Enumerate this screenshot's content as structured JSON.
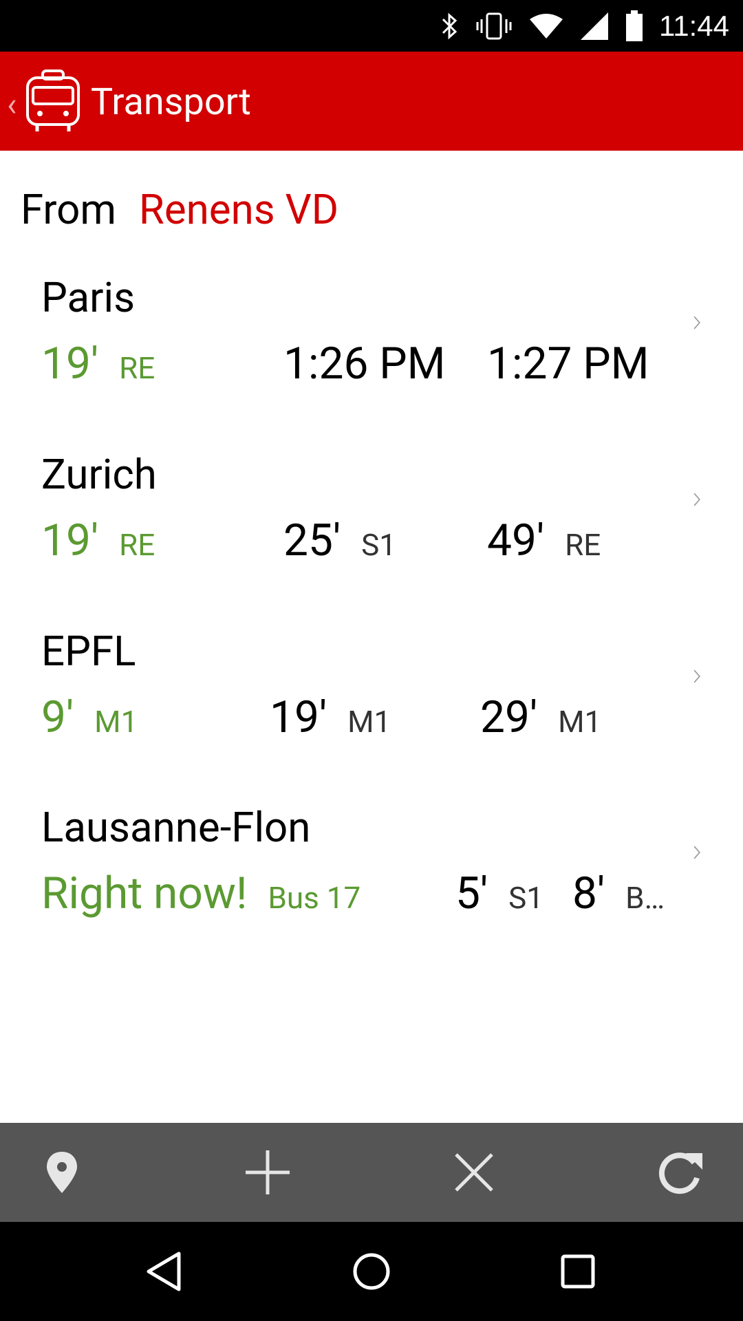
{
  "status_bar": {
    "time": "11:44",
    "icons": [
      "bluetooth-icon",
      "vibrate-icon",
      "wifi-icon",
      "signal-icon",
      "battery-icon"
    ]
  },
  "app_bar": {
    "title": "Transport",
    "logo_icon": "bus-icon",
    "back_icon": "back-chevron-icon",
    "color": "#d20000"
  },
  "from": {
    "label": "From",
    "station": "Renens VD"
  },
  "destinations": [
    {
      "name": "Paris",
      "departures": [
        {
          "time": "19'",
          "line": "RE"
        },
        {
          "time": "1:26 PM",
          "line": ""
        },
        {
          "time": "1:27 PM",
          "line": ""
        }
      ]
    },
    {
      "name": "Zurich",
      "departures": [
        {
          "time": "19'",
          "line": "RE"
        },
        {
          "time": "25'",
          "line": "S1"
        },
        {
          "time": "49'",
          "line": "RE"
        }
      ]
    },
    {
      "name": "EPFL",
      "departures": [
        {
          "time": "9'",
          "line": "M1"
        },
        {
          "time": "19'",
          "line": "M1"
        },
        {
          "time": "29'",
          "line": "M1"
        }
      ]
    },
    {
      "name": "Lausanne-Flon",
      "departures": [
        {
          "time": "Right now!",
          "line": "Bus 17"
        },
        {
          "time": "5'",
          "line": "S1"
        },
        {
          "time": "8'",
          "line": "B…"
        }
      ]
    }
  ],
  "toolbar": {
    "actions": [
      "location-pin-icon",
      "add-icon",
      "close-icon",
      "refresh-icon"
    ]
  },
  "nav_bar": {
    "buttons": [
      "back-triangle-icon",
      "home-circle-icon",
      "recents-square-icon"
    ]
  },
  "colors": {
    "first_departure": "#5b9a32",
    "accent": "#d20000",
    "toolbar": "#555555"
  }
}
